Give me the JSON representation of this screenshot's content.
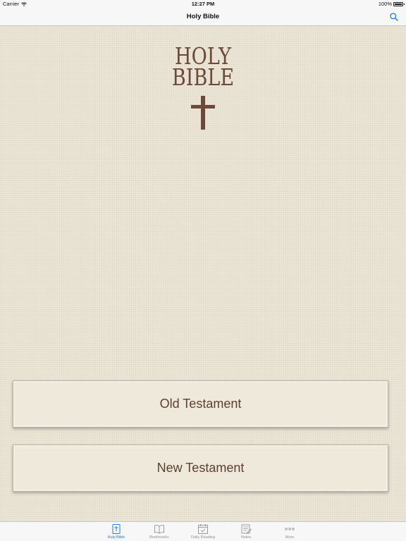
{
  "status_bar": {
    "carrier": "Carrier",
    "time": "12:27 PM",
    "battery": "100%",
    "battery_level": 1.0
  },
  "nav_bar": {
    "title": "Holy Bible",
    "search_icon": "search-icon"
  },
  "logo": {
    "line1": "HOLY",
    "line2": "BIBLE",
    "icon": "cross-icon"
  },
  "buttons": {
    "old_testament": "Old Testament",
    "new_testament": "New Testament"
  },
  "tab_bar": {
    "items": [
      {
        "label": "Holy Bible",
        "icon": "bible-icon",
        "active": true
      },
      {
        "label": "Bookmarks",
        "icon": "book-open-icon",
        "active": false
      },
      {
        "label": "Daily Reading",
        "icon": "calendar-check-icon",
        "active": false
      },
      {
        "label": "Notes",
        "icon": "notes-icon",
        "active": false
      },
      {
        "label": "More",
        "icon": "more-icon",
        "active": false
      }
    ]
  },
  "colors": {
    "accent": "#1c7cf4",
    "brown": "#6b4a3a",
    "linen": "#ece6d8",
    "tab_inactive": "#929292"
  }
}
